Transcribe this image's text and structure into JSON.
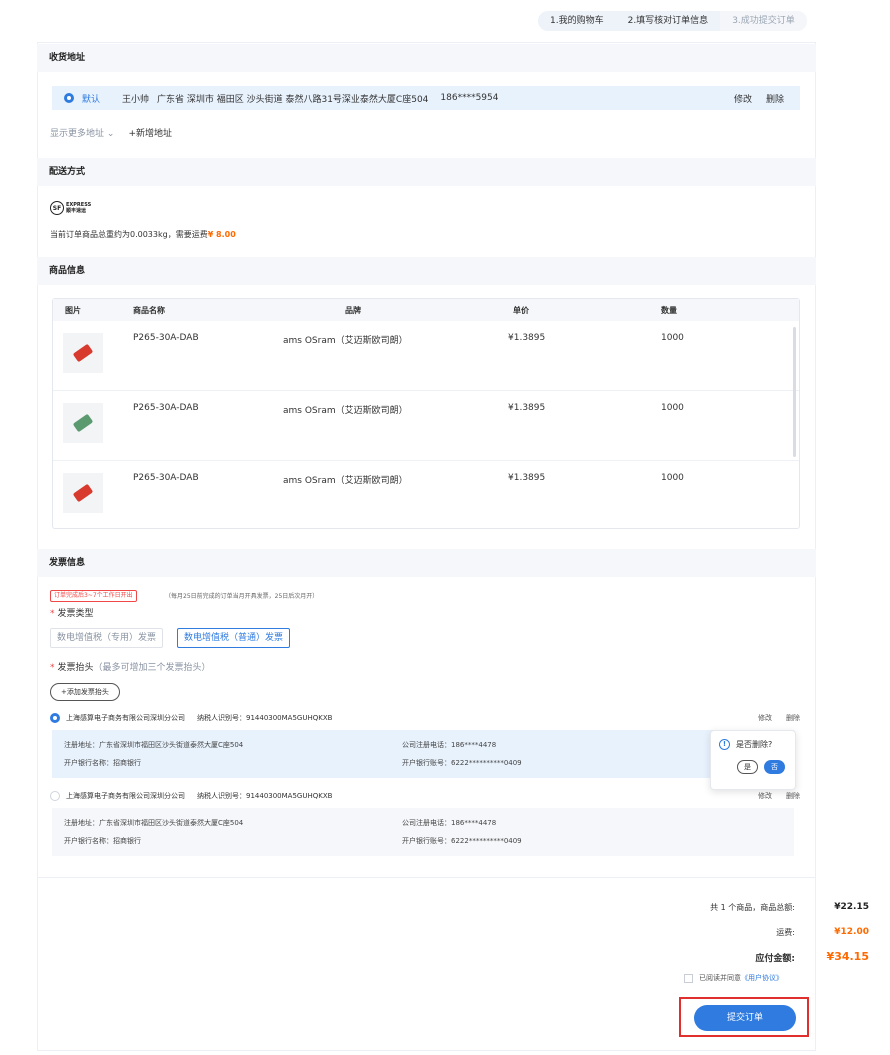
{
  "steps": [
    {
      "label": "1.我的购物车"
    },
    {
      "label": "2.填写核对订单信息"
    },
    {
      "label": "3.成功提交订单"
    }
  ],
  "address": {
    "section_title": "收货地址",
    "default_label": "默认",
    "name": "王小帅",
    "detail": "广东省 深圳市 福田区 沙头街道 泰然八路31号深业泰然大厦C座504",
    "phone": "186****5954",
    "edit_label": "修改",
    "delete_label": "删除",
    "show_more_label": "显示更多地址",
    "add_label": "+新增地址"
  },
  "shipping": {
    "section_title": "配送方式",
    "carrier_logo_text": "SF",
    "carrier_logo_line1": "EXPRESS",
    "carrier_logo_line2": "顺丰速运",
    "note_prefix": "当前订单商品总重约为0.0033kg，需要运费",
    "fee": "¥ 8.00"
  },
  "products": {
    "section_title": "商品信息",
    "columns": [
      "图片",
      "商品名称",
      "品牌",
      "单价",
      "数量"
    ],
    "rows": [
      {
        "name": "P265-30A-DAB",
        "brand": "ams OSram（艾迈斯欧司朗）",
        "price": "¥1.3895",
        "qty": "1000",
        "chip_color": "#d83a2e"
      },
      {
        "name": "P265-30A-DAB",
        "brand": "ams OSram（艾迈斯欧司朗）",
        "price": "¥1.3895",
        "qty": "1000",
        "chip_color": "#5a9a6e"
      },
      {
        "name": "P265-30A-DAB",
        "brand": "ams OSram（艾迈斯欧司朗）",
        "price": "¥1.3895",
        "qty": "1000",
        "chip_color": "#d83a2e"
      }
    ]
  },
  "invoice": {
    "section_title": "发票信息",
    "timing_tag": "订单完成后3~7个工作日开出",
    "timing_note": "（每月25日前完成的订单当月开具发票，25日后次月开）",
    "type_label": "发票类型",
    "type_options": [
      "数电增值税（专用）发票",
      "数电增值税（普通）发票"
    ],
    "head_label": "发票抬头",
    "head_hint": "（最多可增加三个发票抬头）",
    "add_head_label": "+添加发票抬头",
    "titles": [
      {
        "company": "上海感算电子商务有限公司深圳分公司",
        "tax_id": "纳税人识别号：91440300MA5GUHQKXB",
        "reg_addr": "注册地址：广东省深圳市福田区沙头街道泰然大厦C座504",
        "bank_name": "开户银行名称：招商银行",
        "reg_phone": "公司注册电话：186****4478",
        "bank_account": "开户银行账号：6222**********0409",
        "edit_label": "修改",
        "delete_label": "删除"
      },
      {
        "company": "上海感算电子商务有限公司深圳分公司",
        "tax_id": "纳税人识别号：91440300MA5GUHQKXB",
        "reg_addr": "注册地址：广东省深圳市福田区沙头街道泰然大厦C座504",
        "bank_name": "开户银行名称：招商银行",
        "reg_phone": "公司注册电话：186****4478",
        "bank_account": "开户银行账号：6222**********0409",
        "edit_label": "修改",
        "delete_label": "删除"
      }
    ],
    "confirm_popover": {
      "question": "是否删除?",
      "yes_label": "是",
      "no_label": "否"
    }
  },
  "summary": {
    "items_label": "共 1 个商品，商品总额:",
    "items_total": "¥22.15",
    "shipping_label": "运费:",
    "shipping_total": "¥12.00",
    "payable_label": "应付金额:",
    "payable_total": "¥34.15",
    "agree_prefix": "已阅读并同意",
    "agree_link": "《用户协议》",
    "submit_label": "提交订单"
  },
  "colors": {
    "accent": "#2f7be0",
    "price": "#ff6a00",
    "danger": "#e0302e"
  }
}
